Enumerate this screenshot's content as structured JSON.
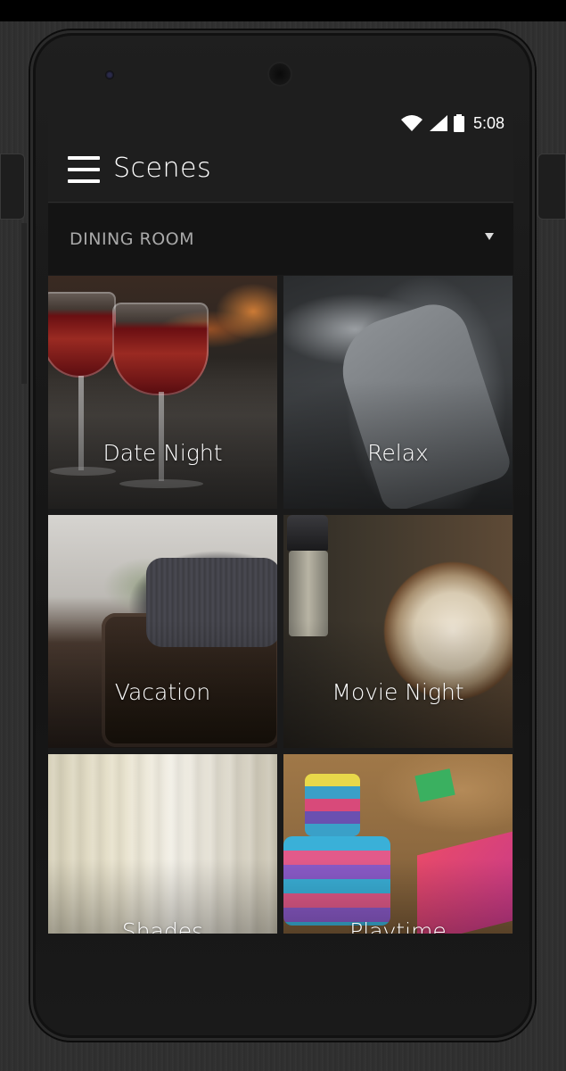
{
  "status_bar": {
    "time": "5:08",
    "icons": [
      "wifi-icon",
      "signal-icon",
      "battery-icon"
    ]
  },
  "app_bar": {
    "title": "Scenes",
    "menu_icon": "hamburger-menu-icon"
  },
  "room_selector": {
    "selected": "DINING ROOM",
    "icon": "dropdown-caret-icon"
  },
  "scenes": [
    {
      "label": "Date Night"
    },
    {
      "label": "Relax"
    },
    {
      "label": "Vacation"
    },
    {
      "label": "Movie Night"
    },
    {
      "label": "Shades"
    },
    {
      "label": "Playtime"
    }
  ],
  "colors": {
    "screen_background": "#1a1a1a",
    "app_bar": "#1e1e1e",
    "room_selector": "#141414",
    "title_text": "#ffffff",
    "room_label_text": "#a9a9a9"
  }
}
